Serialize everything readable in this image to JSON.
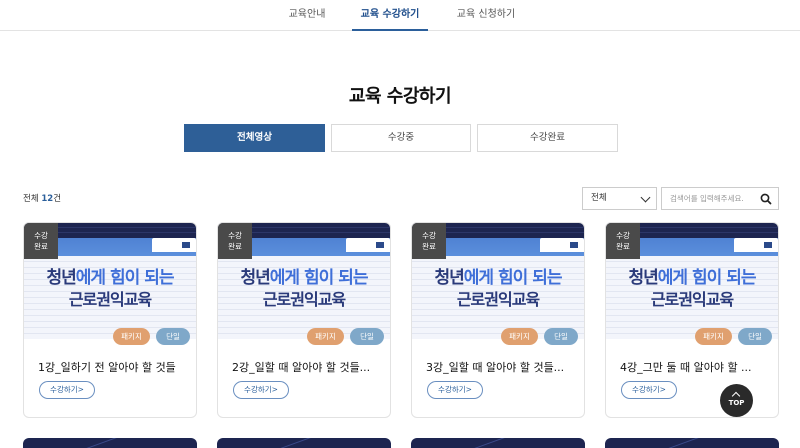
{
  "nav": {
    "tabs": [
      {
        "label": "교육안내"
      },
      {
        "label": "교육 수강하기"
      },
      {
        "label": "교육 신청하기"
      }
    ]
  },
  "page": {
    "title": "교육 수강하기"
  },
  "filters": [
    {
      "label": "전체영상"
    },
    {
      "label": "수강중"
    },
    {
      "label": "수강완료"
    }
  ],
  "summary": {
    "prefix": "전체 ",
    "count": "12",
    "suffix": "건"
  },
  "controls": {
    "select_value": "전체",
    "search_placeholder": "검색어를 입력해주세요."
  },
  "colors": {
    "accent": "#2e5f97",
    "package_tag": "#e0a06f",
    "single_tag": "#7fa8c9",
    "status_badge": "#4a4a4a"
  },
  "thumbnail": {
    "line1_a": "청년",
    "line1_b": "에게 힘이 되는",
    "line2": "근로권익교육"
  },
  "cards": [
    {
      "status": "수강\n완료",
      "tag_package": "패키지",
      "tag_single": "단일",
      "title": "1강_일하기 전 알아야 할 것들",
      "button": "수강하기>"
    },
    {
      "status": "수강\n완료",
      "tag_package": "패키지",
      "tag_single": "단일",
      "title": "2강_일할 때 알아야 할 것들...",
      "button": "수강하기>"
    },
    {
      "status": "수강\n완료",
      "tag_package": "패키지",
      "tag_single": "단일",
      "title": "3강_일할 때 알아야 할 것들...",
      "button": "수강하기>"
    },
    {
      "status": "수강\n완료",
      "tag_package": "패키지",
      "tag_single": "단일",
      "title": "4강_그만 둘 때 알아야 할 ...",
      "button": "수강하기>"
    }
  ],
  "top_button": {
    "label": "TOP"
  }
}
